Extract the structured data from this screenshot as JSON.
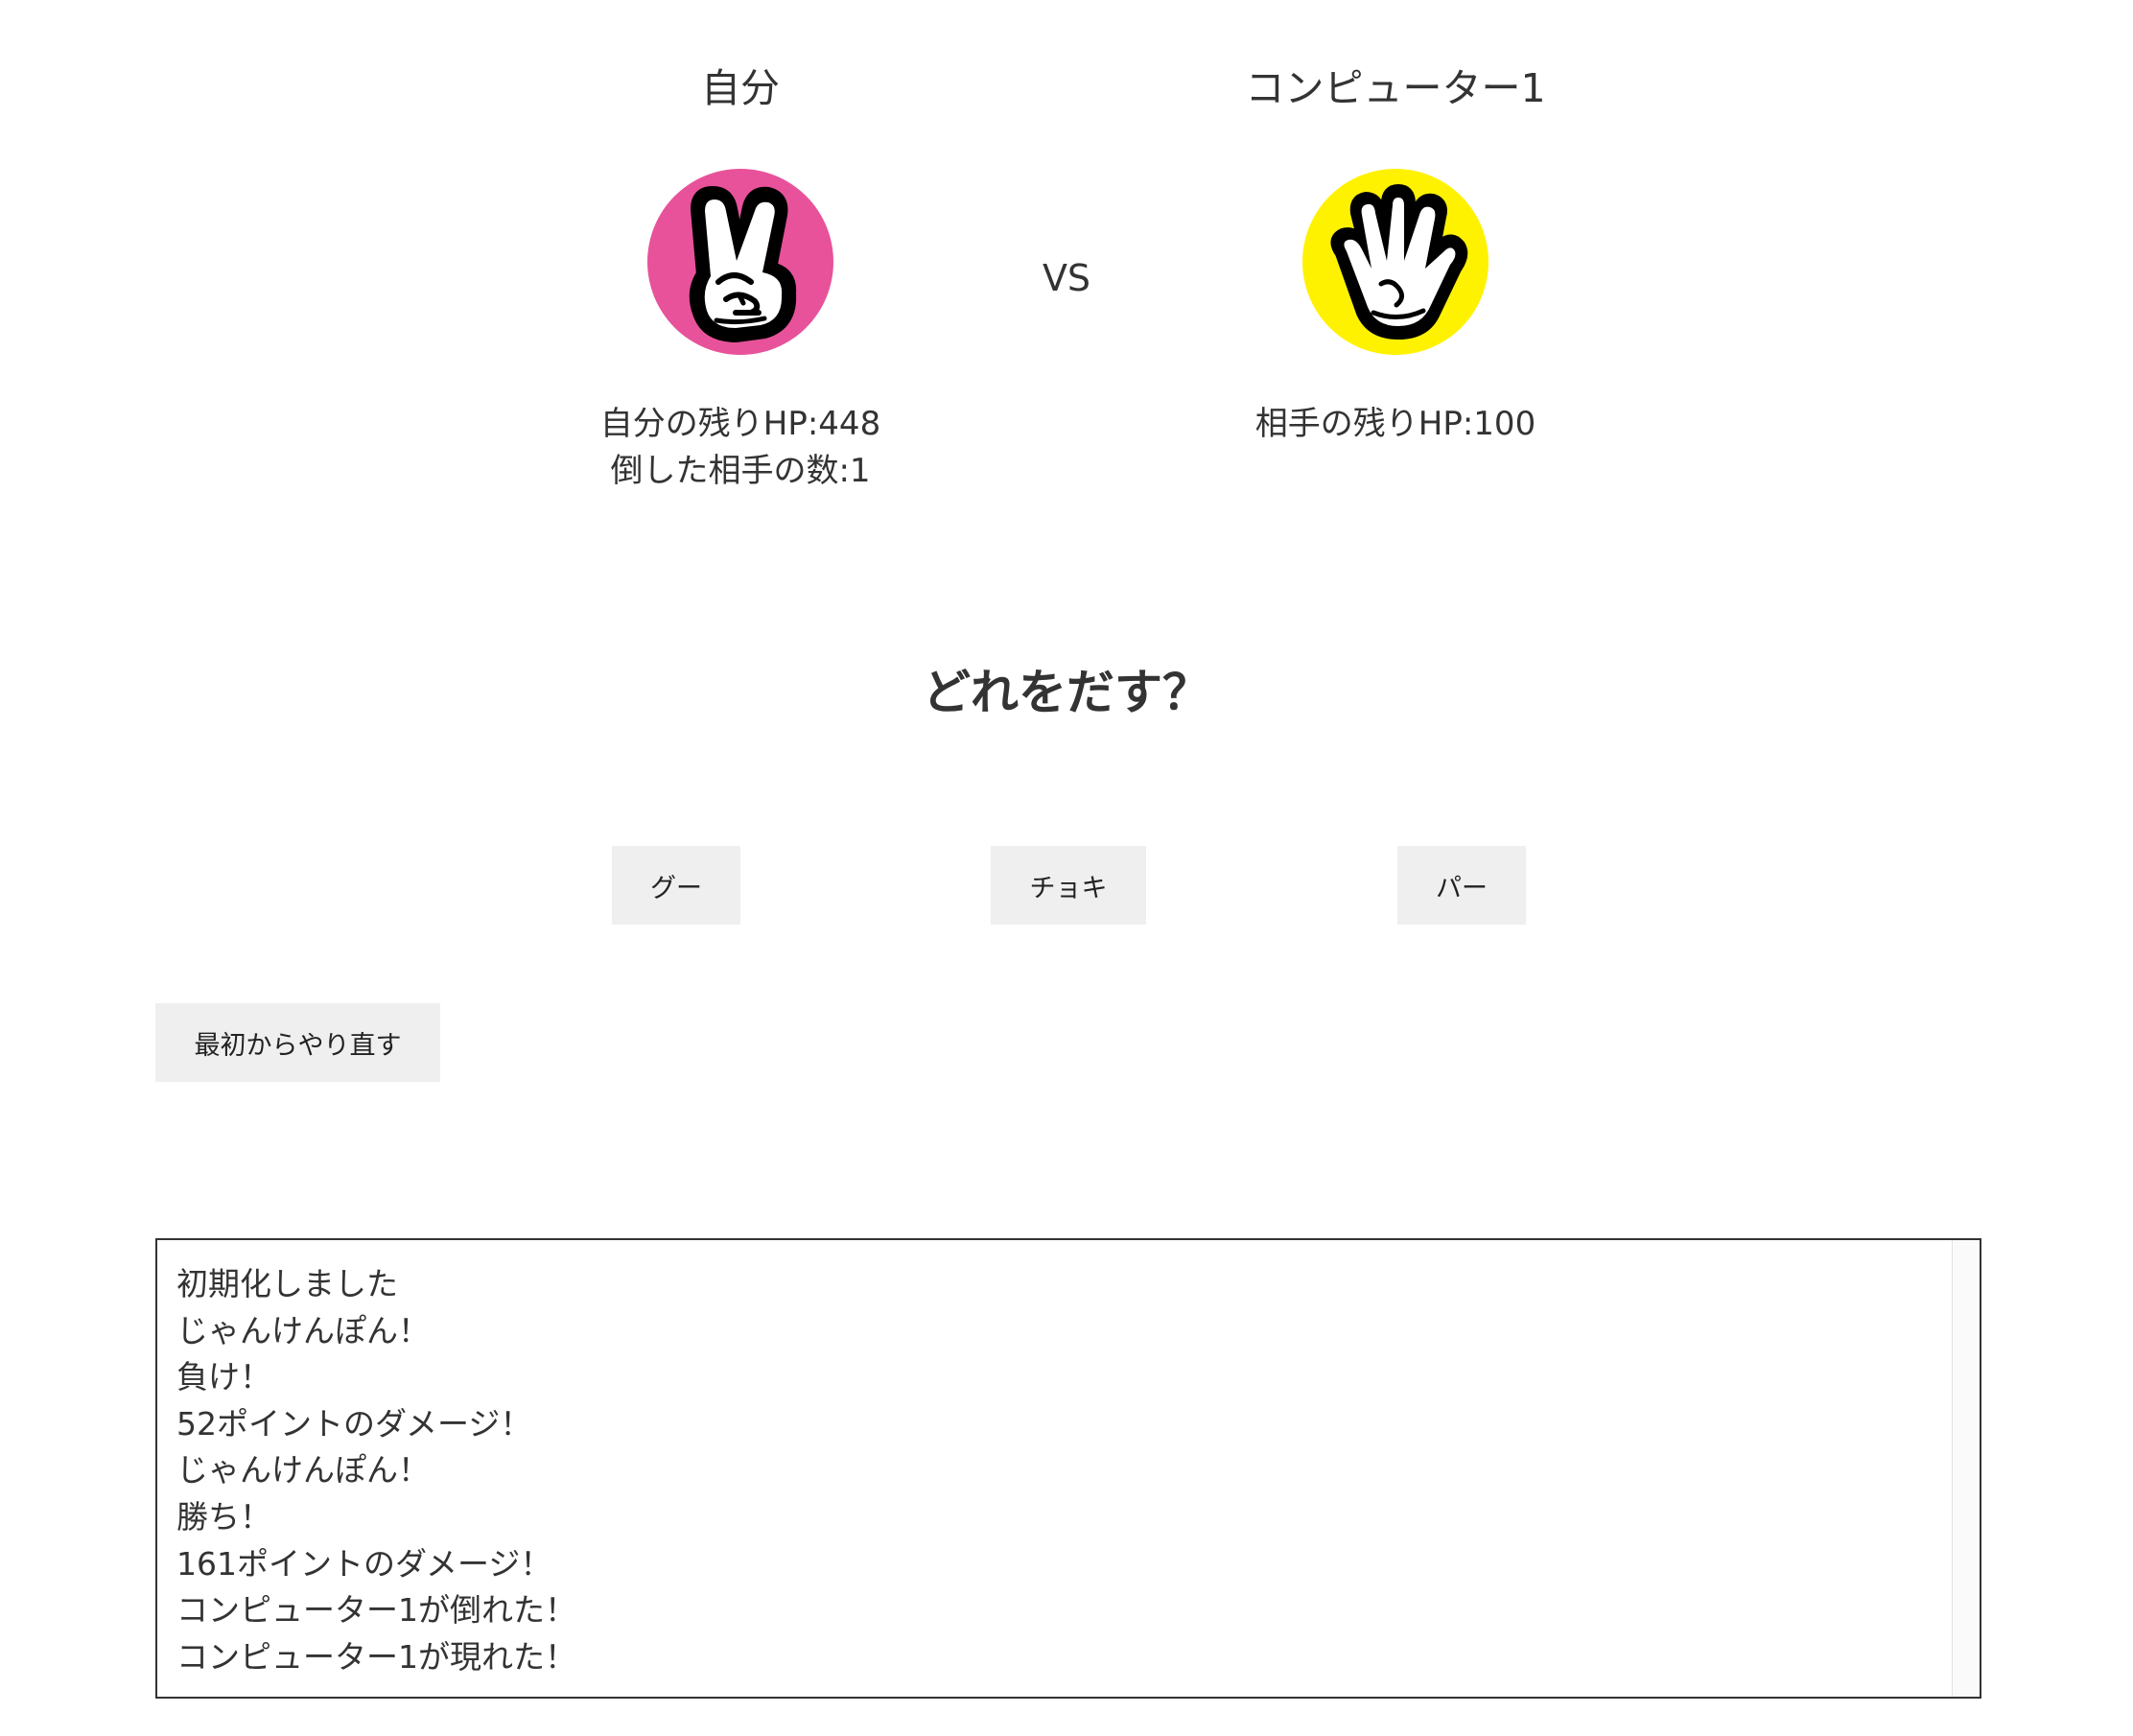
{
  "players": {
    "me": {
      "name": "自分",
      "hand": "choki",
      "hand_color": "#e8529a",
      "hp_text": "自分の残りHP:448",
      "defeated_text": "倒した相手の数:1"
    },
    "cpu": {
      "name": "コンピューター1",
      "hand": "pa",
      "hand_color": "#fff200",
      "hp_text": "相手の残りHP:100"
    }
  },
  "vs_label": "VS",
  "question": "どれをだす？",
  "buttons": {
    "gu": "グー",
    "choki": "チョキ",
    "pa": "パー",
    "reset": "最初からやり直す"
  },
  "log": [
    "初期化しました",
    "じゃんけんぽん！",
    "負け！",
    "52ポイントのダメージ！",
    "じゃんけんぽん！",
    "勝ち！",
    "161ポイントのダメージ！",
    "コンピューター1が倒れた！",
    "コンピューター1が現れた！"
  ]
}
